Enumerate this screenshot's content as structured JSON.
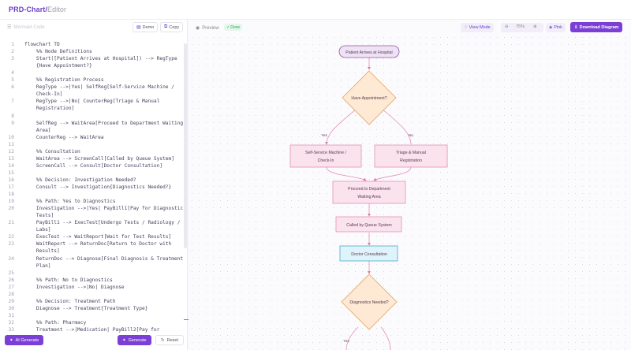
{
  "app": {
    "brand": "PRD-Chart",
    "brand_sep": "/",
    "brand_sub": "Editor"
  },
  "left_panel": {
    "title": "Mermaid Code",
    "demo_label": "Demo",
    "copy_label": "Copy",
    "ai_generate_label": "AI Generate",
    "generate_label": "Generate",
    "reset_label": "Reset",
    "code_lines": [
      {
        "n": "1",
        "t": "flowchart TD"
      },
      {
        "n": "2",
        "t": "    %% Node Definitions"
      },
      {
        "n": "3",
        "t": "    Start([Patient Arrives at Hospital]) --> RegType"
      },
      {
        "n": "",
        "t": "    {Have Appointment?}"
      },
      {
        "n": "4",
        "t": ""
      },
      {
        "n": "5",
        "t": "    %% Registration Process"
      },
      {
        "n": "6",
        "t": "    RegType -->|Yes| SelfReg[Self-Service Machine /"
      },
      {
        "n": "",
        "t": "    Check-In]"
      },
      {
        "n": "7",
        "t": "    RegType -->|No| CounterReg[Triage & Manual"
      },
      {
        "n": "",
        "t": "    Registration]"
      },
      {
        "n": "8",
        "t": ""
      },
      {
        "n": "9",
        "t": "    SelfReg --> WaitArea[Proceed to Department Waiting"
      },
      {
        "n": "",
        "t": "    Area]"
      },
      {
        "n": "10",
        "t": "    CounterReg --> WaitArea"
      },
      {
        "n": "11",
        "t": ""
      },
      {
        "n": "12",
        "t": "    %% Consultation"
      },
      {
        "n": "13",
        "t": "    WaitArea --> ScreenCall[Called by Queue System]"
      },
      {
        "n": "14",
        "t": "    ScreenCall --> Consult[Doctor Consultation]"
      },
      {
        "n": "15",
        "t": ""
      },
      {
        "n": "16",
        "t": "    %% Decision: Investigation Needed?"
      },
      {
        "n": "17",
        "t": "    Consult --> Investigation{Diagnostics Needed?}"
      },
      {
        "n": "18",
        "t": ""
      },
      {
        "n": "19",
        "t": "    %% Path: Yes to Diagnostics"
      },
      {
        "n": "20",
        "t": "    Investigation -->|Yes| PayBill1[Pay for Diagnostic"
      },
      {
        "n": "",
        "t": "    Tests]"
      },
      {
        "n": "21",
        "t": "    PayBill1 --> ExecTest[Undergo Tests / Radiology /"
      },
      {
        "n": "",
        "t": "    Labs]"
      },
      {
        "n": "22",
        "t": "    ExecTest --> WaitReport[Wait for Test Results]"
      },
      {
        "n": "23",
        "t": "    WaitReport --> ReturnDoc[Return to Doctor with"
      },
      {
        "n": "",
        "t": "    Results]"
      },
      {
        "n": "24",
        "t": "    ReturnDoc --> Diagnose[Final Diagnosis & Treatment"
      },
      {
        "n": "",
        "t": "    Plan]"
      },
      {
        "n": "25",
        "t": ""
      },
      {
        "n": "26",
        "t": "    %% Path: No to Diagnostics"
      },
      {
        "n": "27",
        "t": "    Investigation -->|No| Diagnose"
      },
      {
        "n": "28",
        "t": ""
      },
      {
        "n": "29",
        "t": "    %% Decision: Treatment Path"
      },
      {
        "n": "30",
        "t": "    Diagnose --> Treatment{Treatment Type}"
      },
      {
        "n": "31",
        "t": ""
      },
      {
        "n": "32",
        "t": "    %% Path: Pharmacy"
      },
      {
        "n": "33",
        "t": "    Treatment -->|Medication| PayBill2[Pay for"
      }
    ]
  },
  "right_panel": {
    "preview_label": "Preview",
    "status": "Done",
    "view_mode_label": "View Mode",
    "zoom_level": "75%",
    "theme_label": "Pink",
    "download_label": "Download Diagram"
  },
  "diagram": {
    "start": "Patient Arrives at Hospital",
    "decision1": "Have Appointment?",
    "yes": "Yes",
    "no": "No",
    "self_reg_l1": "Self-Service Machine /",
    "self_reg_l2": "Check-In",
    "counter_l1": "Triage & Manual",
    "counter_l2": "Registration",
    "wait_l1": "Proceed to Department",
    "wait_l2": "Waiting Area",
    "queue": "Called by Queue System",
    "consult": "Doctor Consultation",
    "decision2": "Diagnostics Needed?",
    "yes2": "Yes"
  }
}
